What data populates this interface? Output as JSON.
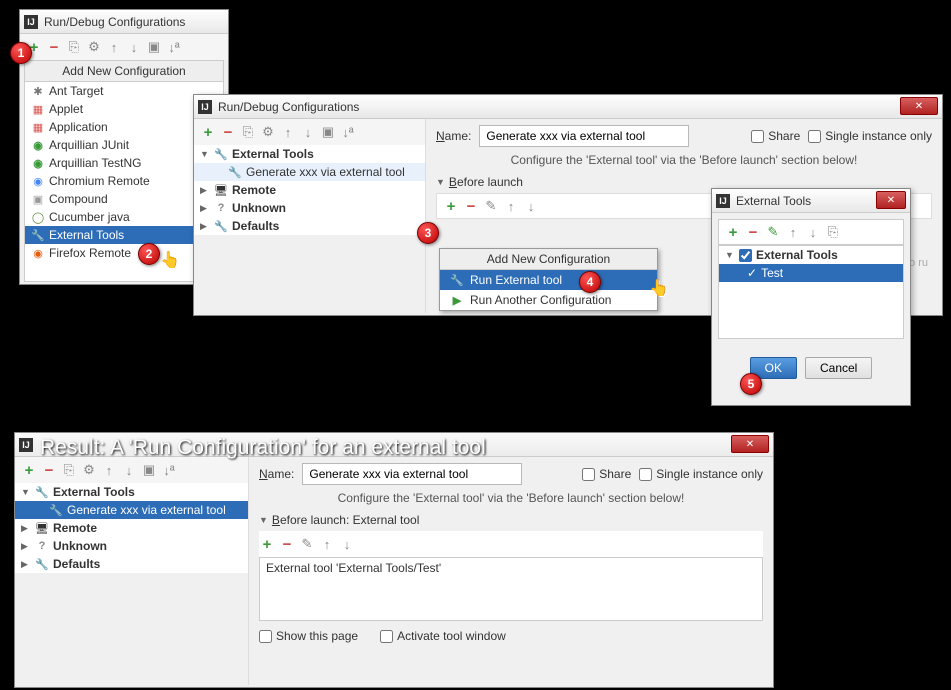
{
  "window1": {
    "title": "Run/Debug Configurations",
    "add_header": "Add New Configuration",
    "items": [
      {
        "label": "Ant Target",
        "icon": "ant"
      },
      {
        "label": "Applet",
        "icon": "app"
      },
      {
        "label": "Application",
        "icon": "app"
      },
      {
        "label": "Arquillian JUnit",
        "icon": "green"
      },
      {
        "label": "Arquillian TestNG",
        "icon": "green"
      },
      {
        "label": "Chromium Remote",
        "icon": "chrome"
      },
      {
        "label": "Compound",
        "icon": "folder"
      },
      {
        "label": "Cucumber java",
        "icon": "cucumber"
      },
      {
        "label": "External Tools",
        "icon": "wrench"
      },
      {
        "label": "Firefox Remote",
        "icon": "firefox"
      }
    ]
  },
  "window2": {
    "title": "Run/Debug Configurations",
    "name_label": "Name:",
    "name_value": "Generate xxx via external tool",
    "share_label": "Share",
    "single_label": "Single instance only",
    "config_note": "Configure the 'External tool' via the 'Before launch' section below!",
    "before_launch": "Before launch",
    "tree": {
      "ext_tools": "External Tools",
      "gen_item": "Generate xxx via external tool",
      "remote": "Remote",
      "unknown": "Unknown",
      "defaults": "Defaults"
    },
    "tasks_hint": "ks to ru",
    "popup": {
      "header": "Add New Configuration",
      "item1": "Run External tool",
      "item2": "Run Another Configuration"
    }
  },
  "window3": {
    "title": "External Tools",
    "tree_root": "External Tools",
    "tree_child": "Test",
    "ok": "OK",
    "cancel": "Cancel"
  },
  "result_title": "Result: A 'Run Configuration' for an external tool",
  "window4": {
    "name_label": "Name:",
    "name_value": "Generate xxx via external tool",
    "share_label": "Share",
    "single_label": "Single instance only",
    "config_note": "Configure the 'External tool' via the 'Before launch' section below!",
    "before_launch": "Before launch: External tool",
    "task_text": "External tool 'External Tools/Test'",
    "show_page": "Show this page",
    "activate": "Activate tool window",
    "tree": {
      "ext_tools": "External Tools",
      "gen_item": "Generate xxx via external tool",
      "remote": "Remote",
      "unknown": "Unknown",
      "defaults": "Defaults"
    }
  },
  "callouts": {
    "c1": "1",
    "c2": "2",
    "c3": "3",
    "c4": "4",
    "c5": "5"
  }
}
